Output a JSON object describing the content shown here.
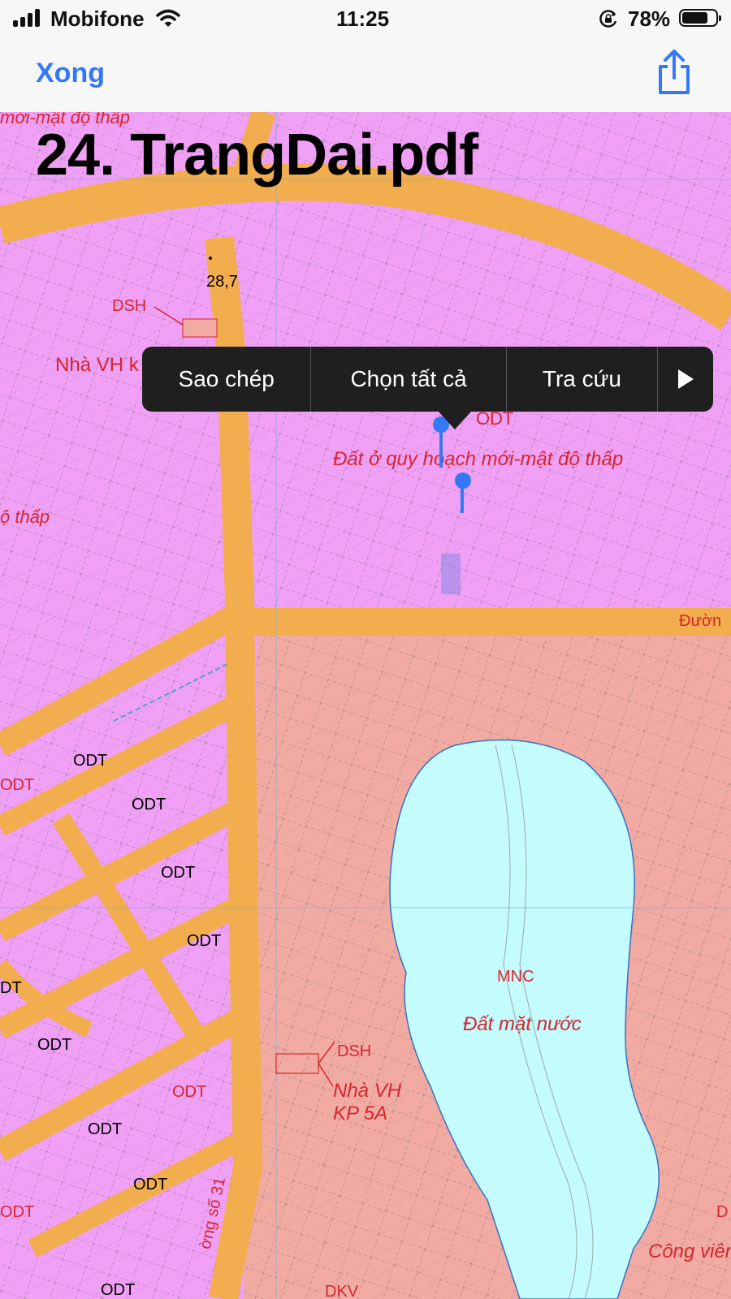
{
  "status_bar": {
    "carrier": "Mobifone",
    "time": "11:25",
    "battery_percent_text": "78%",
    "battery_level": 0.78,
    "signal_icon": "cellular-signal-icon",
    "wifi_icon": "wifi-icon",
    "rotation_lock_icon": "rotation-lock-icon"
  },
  "nav": {
    "done_label": "Xong",
    "share_icon": "share-icon",
    "accent_color": "#3478f6"
  },
  "document": {
    "title": "24. TrangDai.pdf"
  },
  "map": {
    "colors": {
      "residential": "#f0a0f5",
      "road": "#f2ad4e",
      "park": "#f2aba3",
      "water": "#c4fbfd",
      "label_red": "#d6262f"
    },
    "labels": {
      "top_fragment": "mới-mật độ thấp",
      "elevation": "28,7",
      "dsh_top": "DSH",
      "nha_vh_top": "Nhà VH k",
      "odt_center": "ODT",
      "dat_o_center": "Đất ở quy hoạch mới-mật độ thấp",
      "do_thap_left": "ộ thấp",
      "duong_right": "Đườn",
      "odt_1": "ODT",
      "odt_2": "ODT",
      "odt_3": "ODT",
      "odt_4": "ODT",
      "odt_5": "ODT",
      "odt_6": "ODT",
      "odt_7": "ODT",
      "odt_8": "ODT",
      "odt_red_1": "ODT",
      "odt_red_2": "ODT",
      "odt_red_3": "ODT",
      "odt_left_edge": "DT",
      "mnc": "MNC",
      "dat_mat_nuoc": "Đất mặt nước",
      "dsh_bottom": "DSH",
      "nha_vh_kp_line1": "Nhà VH",
      "nha_vh_kp_line2": "KP 5A",
      "cong_vien": "Công viên",
      "d_right": "D",
      "street_name": "ờng số 31",
      "dkv": "DKV"
    }
  },
  "edit_menu": {
    "items": [
      "Sao chép",
      "Chọn tất cả",
      "Tra cứu"
    ],
    "more_icon": "play-arrow-icon"
  }
}
